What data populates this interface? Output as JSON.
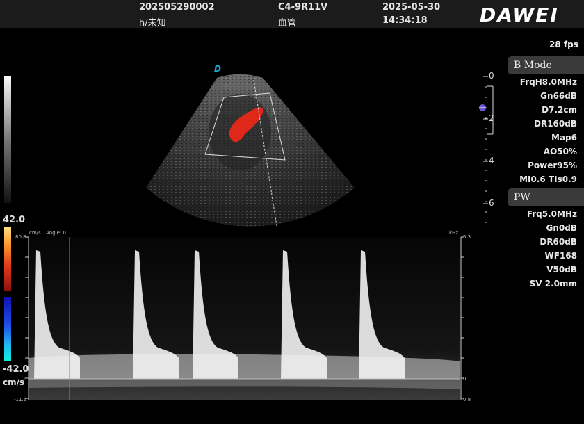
{
  "header": {
    "patient_id": "202505290002",
    "patient_info": "h/未知",
    "probe": "C4-9R11V",
    "exam": "血管",
    "date": "2025-05-30",
    "time": "14:34:18",
    "brand": "DAWEI"
  },
  "fps": "28 fps",
  "bmode": {
    "title": "B Mode",
    "params": [
      "FrqH8.0MHz",
      "Gn66dB",
      "D7.2cm",
      "DR160dB",
      "Map6",
      "AO50%",
      "Power95%",
      "MI0.6 TIs0.9"
    ]
  },
  "pw": {
    "title": "PW",
    "params": [
      "Frq5.0MHz",
      "Gn0dB",
      "DR60dB",
      "WF168",
      "V50dB",
      "SV 2.0mm"
    ]
  },
  "color_scale": {
    "max": "42.0",
    "min": "-42.0",
    "unit": "cm/s"
  },
  "depth_scale": [
    "0",
    "2",
    "4",
    "6"
  ],
  "orientation_marker": "D",
  "spectral": {
    "left_unit": "cm/s",
    "angle_label": "Angle: 0",
    "left_max": "80.8",
    "left_zero": "0",
    "left_min": "-11.6",
    "right_unit": "kHz",
    "right_max": "5.3",
    "right_zero": "0",
    "right_min": "0.8"
  },
  "colors": {
    "flow_red": "#e0281a",
    "mode_header_bg": "#3a3a3a",
    "depth_marker": "#6a5acd"
  }
}
